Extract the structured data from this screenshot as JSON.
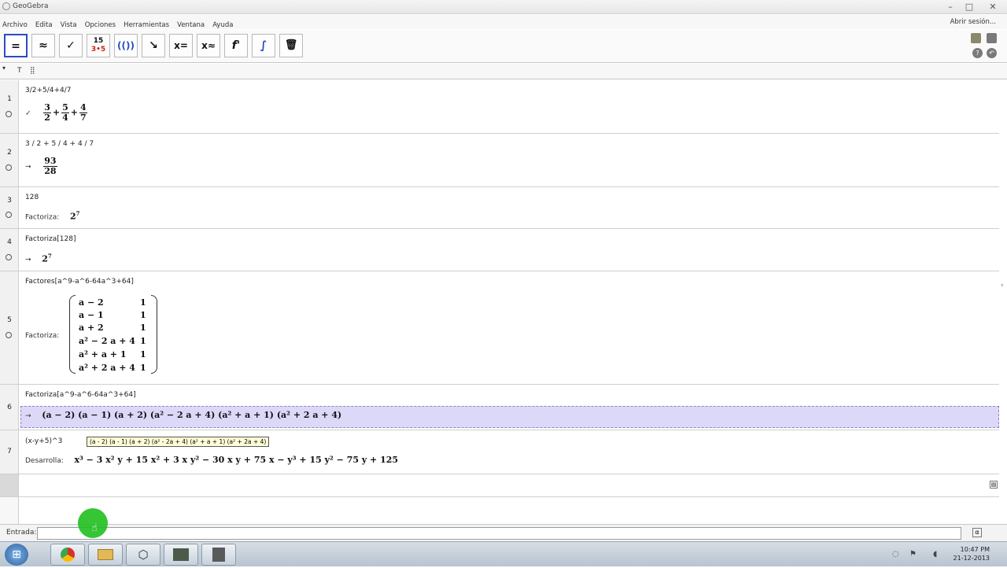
{
  "window": {
    "title": "GeoGebra",
    "minimize": "–",
    "maximize": "□",
    "close": "✕"
  },
  "menu": {
    "items": [
      "Archivo",
      "Edita",
      "Vista",
      "Opciones",
      "Herramientas",
      "Ventana",
      "Ayuda"
    ],
    "login": "Abrir sesión..."
  },
  "toolbar": {
    "tools": [
      {
        "name": "evaluate-tool",
        "glyph": "="
      },
      {
        "name": "numeric-tool",
        "glyph": "≈"
      },
      {
        "name": "keep-input-tool",
        "glyph": "✓"
      },
      {
        "name": "factor-number-tool",
        "glyph": "15\n3•5"
      },
      {
        "name": "expand-tool",
        "glyph": "(())"
      },
      {
        "name": "substitute-tool",
        "glyph": "↘"
      },
      {
        "name": "solve-tool",
        "glyph": "x="
      },
      {
        "name": "solve-numerically-tool",
        "glyph": "x≈"
      },
      {
        "name": "derivative-tool",
        "glyph": "f'"
      },
      {
        "name": "integral-tool",
        "glyph": "∫"
      },
      {
        "name": "delete-tool",
        "glyph": "🗑"
      }
    ]
  },
  "cas_header": {
    "toggle": "▾",
    "text_tool": "T",
    "layout_tool": "⣿"
  },
  "rows": [
    {
      "num": "1",
      "input": "3/2+5/4+4/7",
      "prefix": "✓",
      "fractions": [
        [
          "3",
          "2"
        ],
        [
          "5",
          "4"
        ],
        [
          "4",
          "7"
        ]
      ]
    },
    {
      "num": "2",
      "input": "3 / 2 + 5 / 4 + 4 / 7",
      "prefix": "→",
      "result": [
        "93",
        "28"
      ]
    },
    {
      "num": "3",
      "input": "128",
      "label": "Factoriza:",
      "result": "2",
      "exp": "7"
    },
    {
      "num": "4",
      "input": "Factoriza[128]",
      "prefix": "→",
      "result": "2",
      "exp": "7"
    },
    {
      "num": "5",
      "input": "Factores[a^9-a^6-64a^3+64]",
      "label": "Factoriza:",
      "matrix": [
        [
          "a − 2",
          "1"
        ],
        [
          "a − 1",
          "1"
        ],
        [
          "a + 2",
          "1"
        ],
        [
          "a² − 2 a + 4",
          "1"
        ],
        [
          "a² + a + 1",
          "1"
        ],
        [
          "a² + 2 a + 4",
          "1"
        ]
      ]
    },
    {
      "num": "6",
      "input": "Factoriza[a^9-a^6-64a^3+64]",
      "prefix": "→",
      "result": "(a − 2)  (a − 1)  (a + 2)  (a² − 2 a + 4)  (a² + a + 1)  (a² + 2 a + 4)"
    },
    {
      "num": "7",
      "input": "(x-y+5)^3",
      "tooltip": "(a - 2) (a - 1) (a + 2) (a² - 2a + 4) (a² + a + 1) (a² + 2a + 4)",
      "label": "Desarrolla:",
      "result": "x³ − 3 x² y + 15 x² + 3 x y² − 30 x y + 75 x − y³ + 15 y² − 75 y + 125"
    }
  ],
  "inputbar": {
    "label": "Entrada:",
    "value": ""
  },
  "taskbar": {
    "start": "⊞",
    "apps": [
      "chrome",
      "folder",
      "geogebra",
      "notebook",
      "recorder"
    ],
    "time": "10:47 PM",
    "date": "21-12-2013"
  },
  "colors": {
    "selection": "#dcd8f7",
    "active_tool_border": "#2b4dbf",
    "cursor_highlight": "#1fbf1f"
  }
}
